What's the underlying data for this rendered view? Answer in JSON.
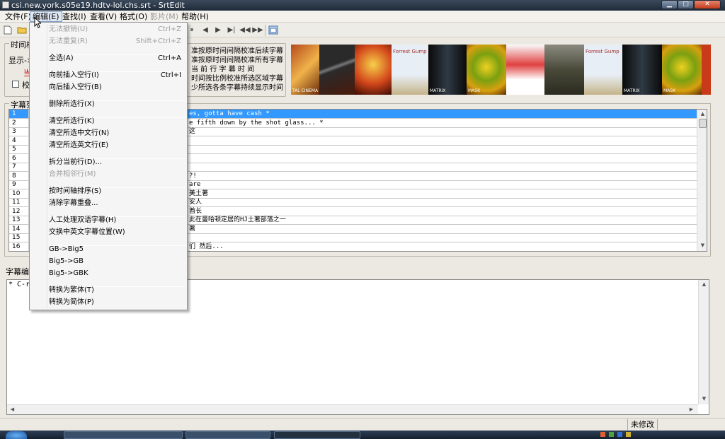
{
  "window": {
    "title": "csi.new.york.s05e19.hdtv-lol.chs.srt - SrtEdit",
    "buttons": {
      "minimize": "▁",
      "maximize": "□",
      "close": "✕"
    }
  },
  "menubar": [
    {
      "label": "文件(F)",
      "state": "normal"
    },
    {
      "label": "编辑(E)",
      "state": "active"
    },
    {
      "label": "查找(I)",
      "state": "normal"
    },
    {
      "label": "查看(V)",
      "state": "normal"
    },
    {
      "label": "格式(O)",
      "state": "normal"
    },
    {
      "label": "影片(M)",
      "state": "disabled"
    },
    {
      "label": "帮助(H)",
      "state": "normal"
    }
  ],
  "toolbar": {
    "icons": [
      "new-file-icon",
      "open-folder-icon",
      "pause-icon",
      "rewind-icon",
      "fast-forward-icon",
      "next-track-icon",
      "skip-back-icon",
      "skip-forward-icon",
      "window-icon"
    ],
    "glyphs": {
      "pause": "⏸",
      "rewind": "◀",
      "forward": "▶",
      "next": "▶|",
      "skipback": "◀◀",
      "skipfwd": "▶▶"
    }
  },
  "time_group": {
    "title": "时间校",
    "display_label": "显示->",
    "current_label": "当",
    "checkbox_label": "校",
    "right_texts": [
      "准按原时间间隔校准后续字幕",
      "准按原时间间隔校准所有字幕",
      "当 前 行 字 幕 时 间",
      "时间按比例校准所选区域字幕",
      "少所选各条字幕持续显示时间"
    ]
  },
  "banner": {
    "poster_texts": [
      "TAL CINEMA",
      "Forrest Gump",
      "MATRIX",
      "MASK",
      "Forrest Gump",
      "MATRIX",
      "MASK"
    ]
  },
  "list_group": {
    "title": "字幕列",
    "rows": [
      {
        "num": "1",
        "text": "es, gotta have cash *",
        "selected": true
      },
      {
        "num": "2",
        "text": "e fifth down by the shot glass... *",
        "selected": false
      },
      {
        "num": "3",
        "text": "这",
        "selected": false
      },
      {
        "num": "4",
        "text": "",
        "selected": false
      },
      {
        "num": "5",
        "text": "",
        "selected": false
      },
      {
        "num": "6",
        "text": "",
        "selected": false
      },
      {
        "num": "7",
        "text": "",
        "selected": false
      },
      {
        "num": "8",
        "text": "?!",
        "selected": false
      },
      {
        "num": "9",
        "text": "are",
        "selected": false
      },
      {
        "num": "10",
        "text": "美土著",
        "selected": false
      },
      {
        "num": "11",
        "text": "安人",
        "selected": false
      },
      {
        "num": "12",
        "text": "酋长",
        "selected": false
      },
      {
        "num": "13",
        "text": "此在曼哈顿定居的HJ土著部落之一",
        "selected": false
      },
      {
        "num": "14",
        "text": "著",
        "selected": false
      },
      {
        "num": "15",
        "text": "",
        "selected": false
      },
      {
        "num": "16",
        "text": "们 然后...",
        "selected": false
      }
    ]
  },
  "edit_group": {
    "title": "字幕编",
    "text": "* C-r"
  },
  "status": {
    "modified": "未修改"
  },
  "edit_menu": {
    "items": [
      {
        "label": "无法撤销(U)",
        "shortcut": "Ctrl+Z",
        "disabled": true
      },
      {
        "label": "无法重复(R)",
        "shortcut": "Shift+Ctrl+Z",
        "disabled": true
      },
      {
        "label": "全选(A)",
        "shortcut": "Ctrl+A",
        "disabled": false
      },
      {
        "label": "向前插入空行(I)",
        "shortcut": "Ctrl+I",
        "disabled": false
      },
      {
        "label": "向后插入空行(B)",
        "shortcut": "",
        "disabled": false
      },
      {
        "label": "删除所选行(X)",
        "shortcut": "",
        "disabled": false
      },
      {
        "label": "清空所选行(K)",
        "shortcut": "",
        "disabled": false
      },
      {
        "label": "清空所选中文行(N)",
        "shortcut": "",
        "disabled": false
      },
      {
        "label": "清空所选英文行(E)",
        "shortcut": "",
        "disabled": false
      },
      {
        "label": "拆分当前行(D)...",
        "shortcut": "",
        "disabled": false
      },
      {
        "label": "合并相邻行(M)",
        "shortcut": "",
        "disabled": true
      },
      {
        "label": "按时间轴排序(S)",
        "shortcut": "",
        "disabled": false
      },
      {
        "label": "消除字幕重叠...",
        "shortcut": "",
        "disabled": false
      },
      {
        "label": "人工处理双语字幕(H)",
        "shortcut": "",
        "disabled": false
      },
      {
        "label": "交换中英文字幕位置(W)",
        "shortcut": "",
        "disabled": false
      },
      {
        "label": "GB->Big5",
        "shortcut": "",
        "disabled": false
      },
      {
        "label": "Big5->GB",
        "shortcut": "",
        "disabled": false
      },
      {
        "label": "Big5->GBK",
        "shortcut": "",
        "disabled": false
      },
      {
        "label": "转换为繁体(T)",
        "shortcut": "",
        "disabled": false
      },
      {
        "label": "转换为简体(P)",
        "shortcut": "",
        "disabled": false
      }
    ]
  },
  "colors": {
    "selection": "#3399ff",
    "menu_highlight": "#dfe7f3",
    "titlebar": "#1e2a38"
  }
}
